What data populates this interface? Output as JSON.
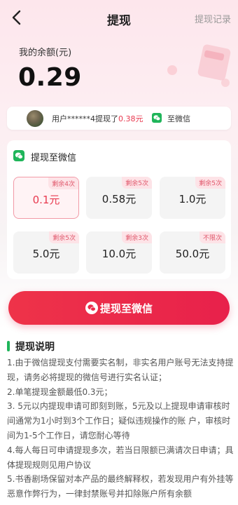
{
  "header": {
    "title": "提现",
    "records": "提现记录"
  },
  "balance": {
    "label": "我的余额(元)",
    "value": "0.29"
  },
  "notice": {
    "prefix": "用户******4提现了",
    "amount": "0.38元",
    "suffix": "至微信"
  },
  "card": {
    "title": "提现至微信",
    "options": [
      {
        "tag": "剩余4次",
        "amount": "0.1元",
        "selected": true
      },
      {
        "tag": "剩余5次",
        "amount": "0.58元",
        "selected": false
      },
      {
        "tag": "剩余5次",
        "amount": "1.0元",
        "selected": false
      },
      {
        "tag": "剩余5次",
        "amount": "5.0元",
        "selected": false
      },
      {
        "tag": "剩余3次",
        "amount": "10.0元",
        "selected": false
      },
      {
        "tag": "不限次",
        "amount": "50.0元",
        "selected": false
      }
    ]
  },
  "button": {
    "label": "提现至微信"
  },
  "explain": {
    "title": "提现说明",
    "lines": [
      "1.由于微信提现支付需要实名制，非实名用户账号无法支持提现，请务必将提现的微信号进行实名认证；",
      "2.单笔提现金额最低0.3元；",
      "3. 5元以内提现申请可即刻到账，5元及以上提现申请审核时间通常为1小时到3个工作日；疑似违规操作的账 户，审核时间为1-5个工作日，请您耐心等待",
      "4.每人每日可申请提现多次，若当日限额已满请次日申请；具体提现规则见用户协议",
      "5.书香剧场保留对本产品的最终解释权，若发现用户有外挂等恶意作弊行为，一律封禁账号并扣除账户所有余额"
    ]
  },
  "colors": {
    "accent": "#e8394f",
    "wechat": "#1fb55a"
  },
  "icons": [
    "back-arrow-icon",
    "wechat-icon",
    "avatar"
  ]
}
